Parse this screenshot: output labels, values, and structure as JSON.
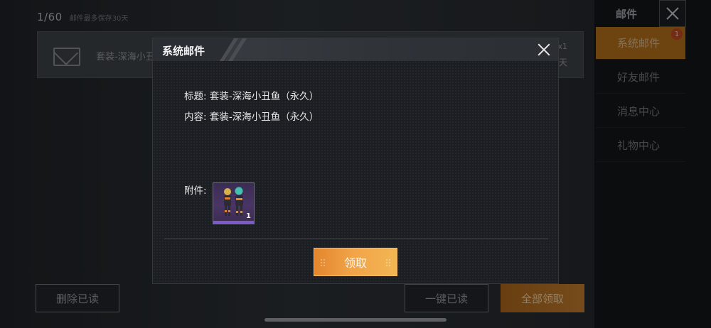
{
  "background": {
    "mail_count": "1/60",
    "mail_note": "邮件最多保存30天",
    "mail_item": {
      "title": "套装-深海小丑",
      "qty": "x1",
      "days": "天"
    },
    "delete_read_label": "删除已读",
    "one_key_read_label": "一键已读",
    "claim_all_label": "全部领取"
  },
  "sidebar": {
    "header": "邮件",
    "badge": "1",
    "items": [
      {
        "label": "系统邮件",
        "active": true
      },
      {
        "label": "好友邮件",
        "active": false
      },
      {
        "label": "消息中心",
        "active": false
      },
      {
        "label": "礼物中心",
        "active": false
      }
    ]
  },
  "modal": {
    "title": "系统邮件",
    "subject_label": "标题:",
    "subject_value": "套装-深海小丑鱼（永久）",
    "content_label": "内容:",
    "content_value": "套装-深海小丑鱼（永久）",
    "attachment_label": "附件:",
    "attachment": {
      "icon": "clown-fish-outfit-icon",
      "count": "1"
    },
    "claim_label": "领取"
  },
  "colors": {
    "accent_orange": "#f1a347",
    "sidebar_active": "#a86718",
    "rarity_purple": "#7b5cc4"
  }
}
